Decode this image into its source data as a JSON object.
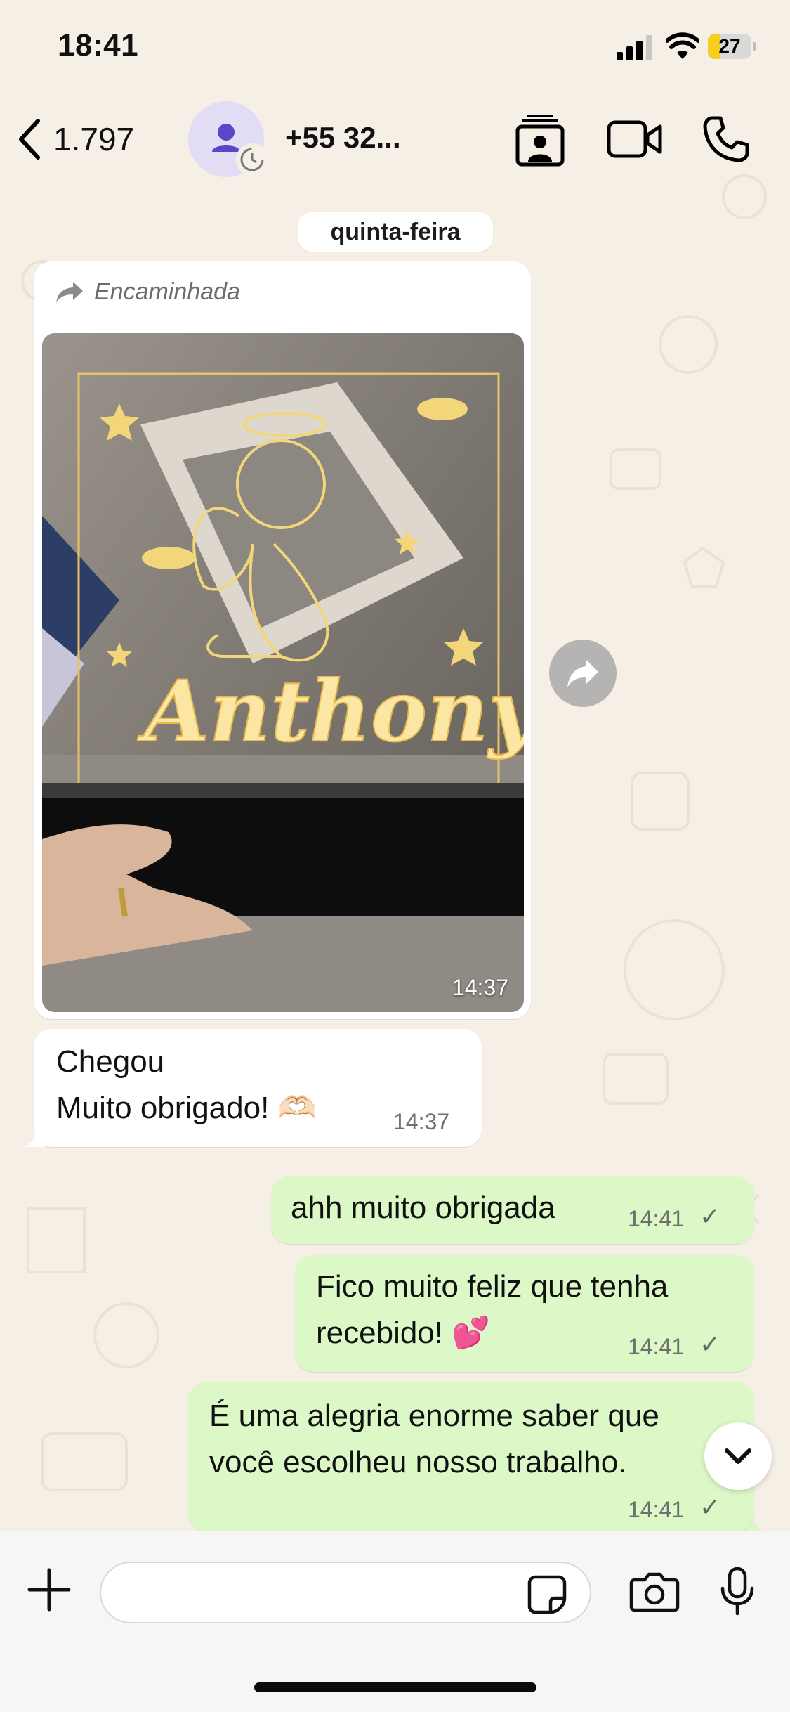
{
  "status_bar": {
    "time": "18:41",
    "battery": "27",
    "battery_level": 0.27
  },
  "header": {
    "back_count": "1.797",
    "contact": "+55 32..."
  },
  "date_label": "quinta-feira",
  "messages": {
    "forwarded": {
      "label": "Encaminhada",
      "photo_text": "Anthony",
      "time": "14:37"
    },
    "incoming_text": {
      "line1": "Chegou",
      "line2": "Muito obrigado! 🫶🏻",
      "time": "14:37"
    },
    "out1": {
      "text": "ahh muito obrigada",
      "time": "14:41"
    },
    "out2": {
      "line1": "Fico muito feliz que tenha",
      "line2": "recebido! 💕",
      "time": "14:41"
    },
    "out3": {
      "line1": "É uma alegria enorme saber que",
      "line2": "você escolheu nosso trabalho.",
      "time": "14:41"
    }
  },
  "composer": {
    "placeholder": ""
  },
  "colors": {
    "chat_bg": "#f5efe6",
    "outgoing_bubble": "#dcf8c6",
    "incoming_bubble": "#ffffff",
    "battery": "#f4cf1e",
    "avatar": "#e3dcf5"
  }
}
